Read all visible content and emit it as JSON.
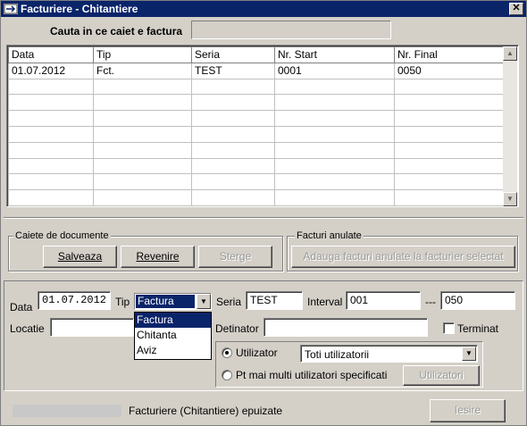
{
  "window": {
    "title": "Facturiere - Chitantiere",
    "close_glyph": "✕"
  },
  "search": {
    "label": "Cauta in ce caiet e factura",
    "value": ""
  },
  "grid": {
    "columns": [
      "Data",
      "Tip",
      "Seria",
      "Nr. Start",
      "Nr. Final"
    ],
    "rows": [
      [
        "01.07.2012",
        "Fct.",
        "TEST",
        "0001",
        "0050"
      ],
      [
        "",
        "",
        "",
        "",
        ""
      ],
      [
        "",
        "",
        "",
        "",
        ""
      ],
      [
        "",
        "",
        "",
        "",
        ""
      ],
      [
        "",
        "",
        "",
        "",
        ""
      ],
      [
        "",
        "",
        "",
        "",
        ""
      ],
      [
        "",
        "",
        "",
        "",
        ""
      ],
      [
        "",
        "",
        "",
        "",
        ""
      ],
      [
        "",
        "",
        "",
        "",
        ""
      ]
    ],
    "scroll_up": "▲",
    "scroll_down": "▼"
  },
  "caiete": {
    "group_label": "Caiete de documente",
    "save_label": "Salveaza",
    "revert_label": "Revenire",
    "delete_label": "Sterge"
  },
  "anulate": {
    "group_label": "Facturi anulate",
    "add_label": "Adauga facturi anulate la facturier selectat"
  },
  "form": {
    "data_label": "Data",
    "data_value": "01.07.2012",
    "tip_label": "Tip",
    "tip_value": "Factura",
    "tip_options": [
      "Factura",
      "Chitanta",
      "Aviz"
    ],
    "seria_label": "Seria",
    "seria_value": "TEST",
    "interval_label": "Interval",
    "interval_from": "001",
    "interval_sep": "---",
    "interval_to": "050",
    "locatie_label": "Locatie",
    "locatie_value": "",
    "detinator_label": "Detinator",
    "detinator_value": "",
    "terminat_label": "Terminat",
    "utilizator_label": "Utilizator",
    "utilizator_value": "Toti utilizatorii",
    "multi_label": "Pt mai multi utilizatori specificati",
    "utilizatori_button": "Utilizatori"
  },
  "footer": {
    "epuizate_label": "Facturiere (Chitantiere) epuizate",
    "exit_label": "Iesire"
  },
  "colors": {
    "title_bar": "#0a246a",
    "selection": "#0a246a",
    "face": "#d4d0c8"
  }
}
